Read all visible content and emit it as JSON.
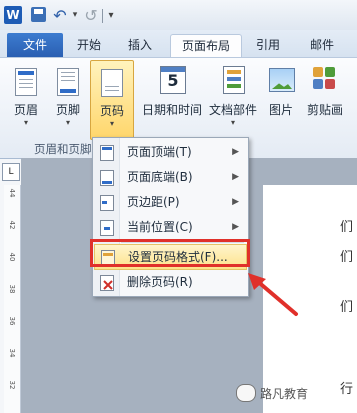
{
  "quick_access": {
    "logo_letter": "W",
    "undo_symbol": "↶",
    "redo_symbol": "↺",
    "dropdown_symbol": "▾"
  },
  "tabs": [
    {
      "label": "文件"
    },
    {
      "label": "开始"
    },
    {
      "label": "插入"
    },
    {
      "label": "页面布局"
    },
    {
      "label": "引用"
    },
    {
      "label": "邮件"
    }
  ],
  "ribbon": {
    "group_label": "页眉和页脚",
    "buttons": [
      {
        "label": "页眉"
      },
      {
        "label": "页脚"
      },
      {
        "label": "页码"
      },
      {
        "label": "日期和时间",
        "icon_text": "5"
      },
      {
        "label": "文档部件"
      },
      {
        "label": "图片"
      },
      {
        "label": "剪贴画"
      }
    ],
    "arrow": "▾"
  },
  "ruler": {
    "corner": "L",
    "numbers": [
      "44",
      "42",
      "40",
      "38",
      "36",
      "34",
      "32"
    ]
  },
  "menu": {
    "items": [
      {
        "label": "页面顶端(T)",
        "submenu": true
      },
      {
        "label": "页面底端(B)",
        "submenu": true
      },
      {
        "label": "页边距(P)",
        "submenu": true
      },
      {
        "label": "当前位置(C)",
        "submenu": true
      },
      {
        "label": "设置页码格式(F)...",
        "submenu": false
      },
      {
        "label": "删除页码(R)",
        "submenu": false
      }
    ],
    "submenu_arrow": "▶"
  },
  "document": {
    "chars": [
      "们",
      "们",
      "们",
      "行"
    ]
  },
  "watermark": "路凡教育",
  "colors": {
    "highlight_border": "#e0302a",
    "file_tab": "#2a5fb2"
  }
}
